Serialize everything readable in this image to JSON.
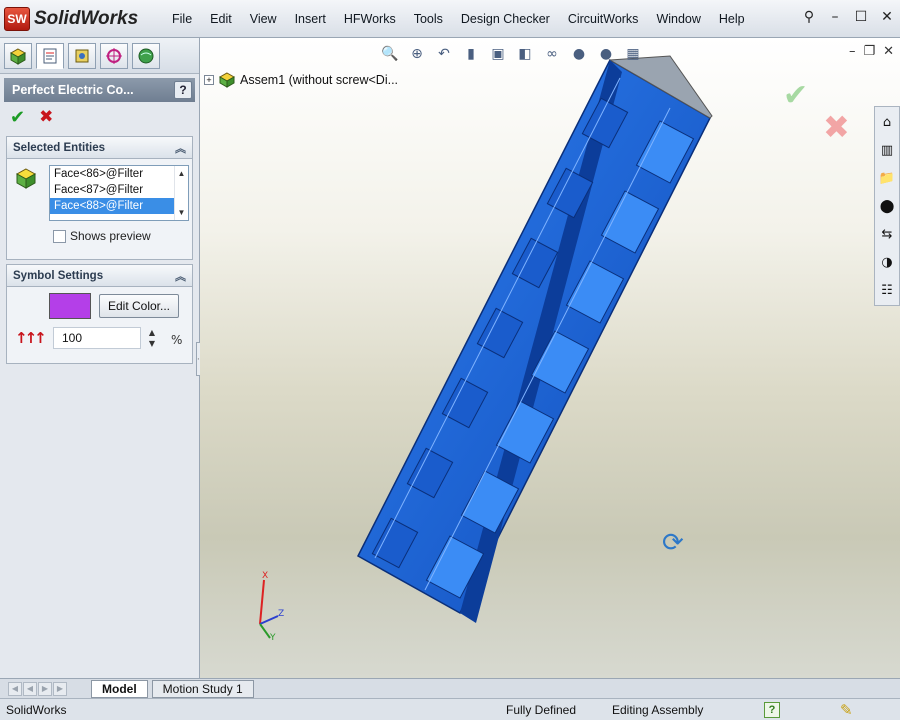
{
  "app": {
    "logo_badge": "SW",
    "title": "SolidWorks"
  },
  "menu": [
    "File",
    "Edit",
    "View",
    "Insert",
    "HFWorks",
    "Tools",
    "Design Checker",
    "CircuitWorks",
    "Window",
    "Help"
  ],
  "window_controls": {
    "pin": "⚲",
    "minimize": "–",
    "restore": "☐",
    "close": "✕"
  },
  "property_manager": {
    "title": "Perfect Electric Co...",
    "help": "?",
    "ok": "✔",
    "cancel": "✖",
    "selected_entities": {
      "header": "Selected Entities",
      "faces": [
        "Face<86>@Filter",
        "Face<87>@Filter",
        "Face<88>@Filter"
      ],
      "selected_index": 2,
      "shows_preview_label": "Shows preview",
      "shows_preview_checked": false
    },
    "symbol_settings": {
      "header": "Symbol Settings",
      "color": "#b43fe8",
      "edit_color_label": "Edit Color...",
      "scale_value": "100",
      "scale_unit": "%"
    }
  },
  "viewport": {
    "tree_node_label": "Assem1  (without screw<Di...",
    "ok_symbol": "✔",
    "cancel_symbol": "✖",
    "triad_labels": {
      "x": "X",
      "y": "Y",
      "z": "Z"
    },
    "model_color": "#1f66d9"
  },
  "bottom_tabs": [
    "Model",
    "Motion Study 1"
  ],
  "status": {
    "app": "SolidWorks",
    "defined": "Fully Defined",
    "editing": "Editing Assembly",
    "help": "?"
  }
}
